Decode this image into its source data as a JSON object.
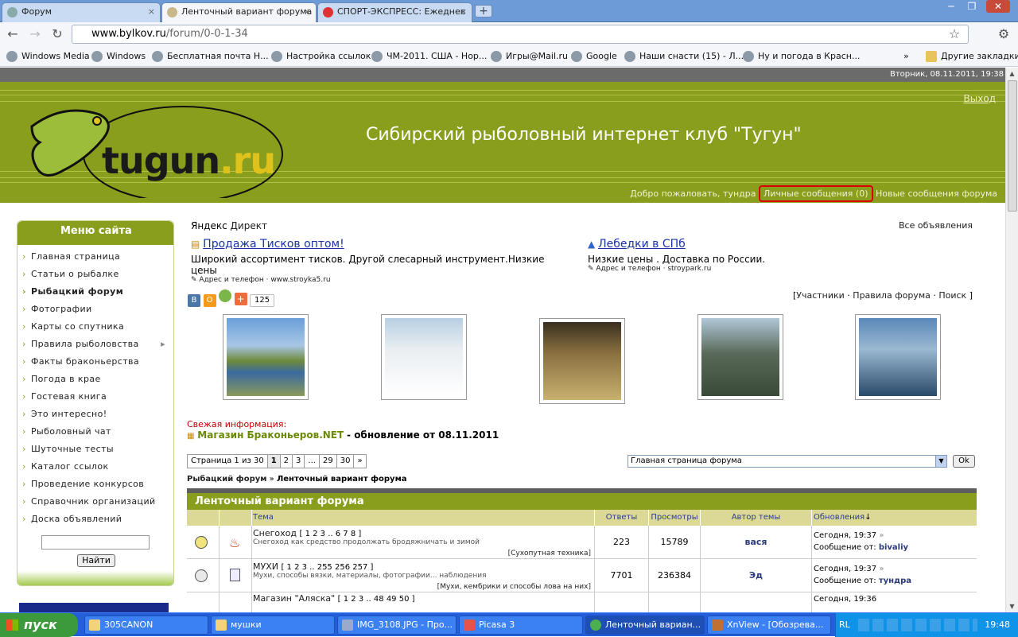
{
  "browser": {
    "tabs": [
      {
        "label": "Форум",
        "active": false
      },
      {
        "label": "Ленточный вариант форума",
        "active": true
      },
      {
        "label": "СПОРТ-ЭКСПРЕСС: Ежеднев",
        "active": false
      }
    ],
    "tab_close": "×",
    "new_tab": "+",
    "window_controls": {
      "minimize": "─",
      "maximize": "❐",
      "close": "✕"
    },
    "url_domain": "www.bylkov.ru",
    "url_path": "/forum/0-0-1-34",
    "nav": {
      "back": "←",
      "forward": "→",
      "reload": "↻",
      "star": "☆",
      "wrench": "⚙"
    },
    "bookmarks": [
      "Windows Media",
      "Windows",
      "Бесплатная почта Н...",
      "Настройка ссылок",
      "ЧМ-2011. США - Нор...",
      "Игры@Mail.ru",
      "Google",
      "Наши снасти (15) - Л...",
      "Ну и погода в Красн..."
    ],
    "bookmarks_more": "»",
    "other_bookmarks": "Другие закладки"
  },
  "site": {
    "datetime": "Вторник, 08.11.2011, 19:38",
    "logo_text_dark": "tugun",
    "logo_text_accent": ".ru",
    "title": "Сибирский рыболовный интернет клуб \"Тугун\"",
    "logout": "Выход",
    "welcome_prefix": "Добро пожаловать,",
    "username": "тундра",
    "private_messages": "Личные сообщения (0)",
    "new_posts": "Новые сообщения форума"
  },
  "sidebar": {
    "heading": "Меню сайта",
    "items": [
      {
        "label": "Главная страница"
      },
      {
        "label": "Статьи о рыбалке"
      },
      {
        "label": "Рыбацкий форум",
        "bold": true
      },
      {
        "label": "Фотографии"
      },
      {
        "label": "Карты со спутника"
      },
      {
        "label": "Правила рыболовства",
        "submenu": true
      },
      {
        "label": "Факты браконьерства"
      },
      {
        "label": "Погода в крае"
      },
      {
        "label": "Гостевая книга"
      },
      {
        "label": "Это интересно!"
      },
      {
        "label": "Рыболовный чат"
      },
      {
        "label": "Шуточные тесты"
      },
      {
        "label": "Каталог ссылок"
      },
      {
        "label": "Проведение конкурсов"
      },
      {
        "label": "Справочник организаций"
      },
      {
        "label": "Доска объявлений"
      }
    ],
    "search_value": "",
    "find_button": "Найти"
  },
  "ads": {
    "yandex": "Яндекс",
    "direct": "Директ",
    "all_ads": "Все объявления",
    "items": [
      {
        "title": "Продажа Тисков оптом!",
        "text": "Широкий ассортимент тисков. Другой слесарный инструмент.Низкие цены",
        "contact": "Адрес и телефон",
        "site": "www.stroyka5.ru"
      },
      {
        "title": "Лебедки в СПб",
        "text": "Низкие цены . Доставка по России.",
        "contact": "Адрес и телефон",
        "site": "stroypark.ru"
      }
    ]
  },
  "share_count": "125",
  "forum_links": [
    "Участники",
    "Правила форума",
    "Поиск"
  ],
  "fresh": {
    "label": "Свежая информация:",
    "link": "Магазин Браконьеров.NET",
    "suffix": "- обновление от 08.11.2011"
  },
  "pager": {
    "label": "Страница 1 из 30",
    "pages": [
      "1",
      "2",
      "3",
      "...",
      "29",
      "30",
      "»"
    ]
  },
  "jump": {
    "selected": "Главная страница форума",
    "ok": "Ok"
  },
  "breadcrumb": {
    "root": "Рыбацкий форум",
    "sep": "»",
    "current": "Ленточный вариант форума"
  },
  "table": {
    "title": "Ленточный вариант форума",
    "columns": [
      "Тема",
      "Ответы",
      "Просмотры",
      "Автор темы",
      "Обновления"
    ],
    "rows": [
      {
        "title": "Снегоход",
        "pages": "[ 1 2 3 .. 6 7 8 ]",
        "desc": "Снегоход как средство продолжать бродяжничать и зимой",
        "category": "Сухопутная техника",
        "replies": "223",
        "views": "15789",
        "author": "вася",
        "updated": "Сегодня, 19:37",
        "from_label": "Сообщение от:",
        "from": "bivaliy"
      },
      {
        "title": "МУХИ",
        "pages": "[ 1 2 3 .. 255 256 257 ]",
        "desc": "Мухи, способы вязки, материалы, фотографии... наблюдения",
        "category": "Мухи, кембрики и способы лова на них",
        "replies": "7701",
        "views": "236384",
        "author": "Эд",
        "updated": "Сегодня, 19:37",
        "from_label": "Сообщение от:",
        "from": "тундра"
      },
      {
        "title": "Магазин \"Аляска\"",
        "pages": "[ 1 2 3 .. 48 49 50 ]",
        "desc": "",
        "category": "",
        "replies": "",
        "views": "",
        "author": "",
        "updated": "Сегодня, 19:36",
        "from_label": "",
        "from": ""
      }
    ]
  },
  "taskbar": {
    "start": "пуск",
    "tasks": [
      "305CANON",
      "мушки",
      "IMG_3108.JPG - Про...",
      "Picasa 3",
      "Ленточный вариан...",
      "XnView - [Обозрева..."
    ],
    "lang": "RL",
    "clock": "19:48"
  }
}
